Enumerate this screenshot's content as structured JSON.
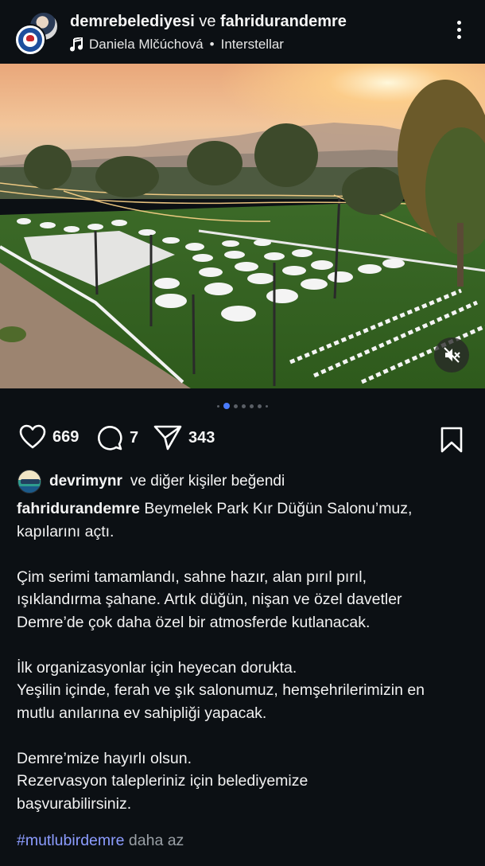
{
  "header": {
    "account_1": "demrebelediyesi",
    "connector": "ve",
    "account_2": "fahridurandemre",
    "audio_artist": "Daniela Mlčúchová",
    "audio_separator": "•",
    "audio_track": "Interstellar"
  },
  "carousel": {
    "count": 7,
    "active_index": 1
  },
  "actions": {
    "likes": "669",
    "comments": "7",
    "shares": "343"
  },
  "liked_by": {
    "user": "devrimynr",
    "text": "ve diğer kişiler beğendi"
  },
  "caption": {
    "user": "fahridurandemre",
    "first_line": "Beymelek Park Kır Düğün Salonu’muz,\nkapılarını açtı.",
    "paragraph_1": "Çim serimi tamamlandı, sahne hazır, alan pırıl pırıl,\nışıklandırma şahane. Artık düğün, nişan ve özel davetler\nDemre’de çok daha özel bir atmosferde kutlanacak.",
    "paragraph_2": "İlk organizasyonlar için heyecan dorukta.\nYeşilin içinde, ferah ve şık salonumuz, hemşehrilerimizin en\nmutlu anılarına ev sahipliği yapacak.",
    "paragraph_3": "Demre’mize hayırlı olsun.\nRezervasyon talepleriniz için belediyemize\nbaşvurabilirsiniz.",
    "hashtag": "#mutlubirdemre",
    "less": "daha az"
  },
  "colors": {
    "background": "#0c1014",
    "hashtag": "#8c9cff",
    "active_dot": "#4a7cff"
  }
}
